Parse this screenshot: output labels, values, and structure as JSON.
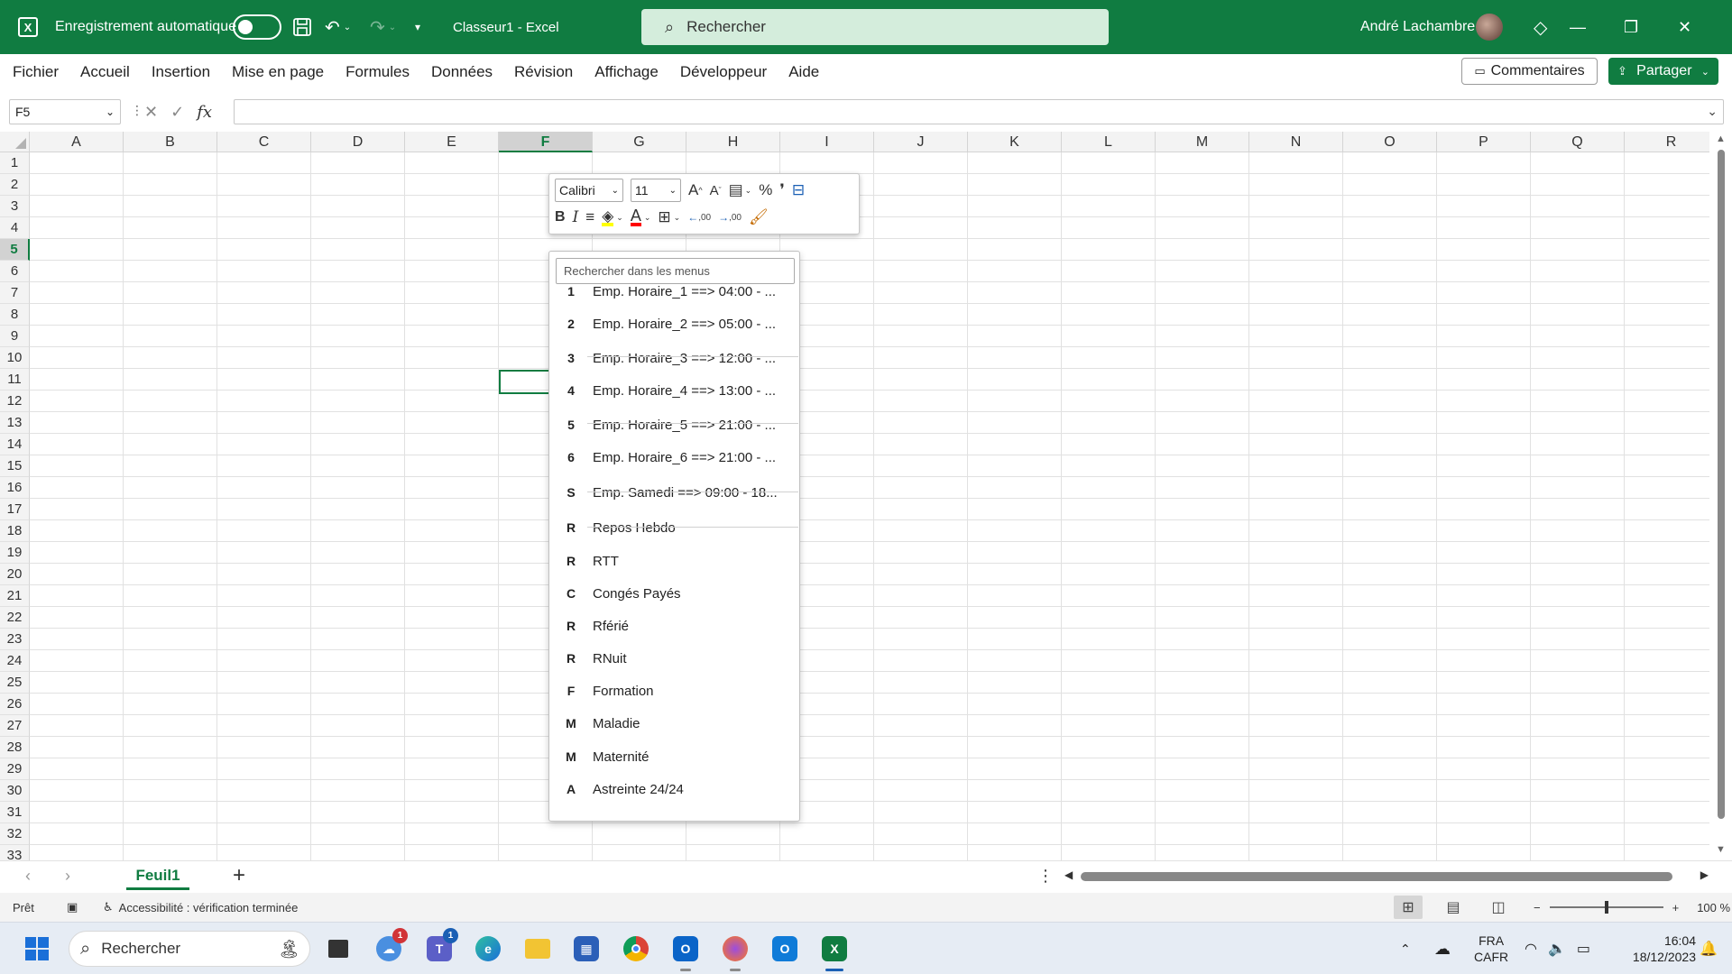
{
  "colors": {
    "accent": "#107C41",
    "titlebar_bg": "#107C41",
    "search_bg": "#d4eddc",
    "fill_color": "#ffff00",
    "font_color": "#ff0000"
  },
  "titlebar": {
    "autosave_label": "Enregistrement automatique",
    "doc_title": "Classeur1  -  Excel",
    "search_placeholder": "Rechercher",
    "user_name": "André Lachambre"
  },
  "menu": {
    "items": [
      "Fichier",
      "Accueil",
      "Insertion",
      "Mise en page",
      "Formules",
      "Données",
      "Révision",
      "Affichage",
      "Développeur",
      "Aide"
    ],
    "comments_label": "Commentaires",
    "share_label": "Partager"
  },
  "formula_bar": {
    "name_box": "F5",
    "fx_label": "fx",
    "formula_value": ""
  },
  "grid": {
    "columns": [
      "A",
      "B",
      "C",
      "D",
      "E",
      "F",
      "G",
      "H",
      "I",
      "J",
      "K",
      "L",
      "M",
      "N",
      "O",
      "P",
      "Q",
      "R"
    ],
    "rows": [
      "1",
      "2",
      "3",
      "4",
      "5",
      "6",
      "7",
      "8",
      "9",
      "10",
      "11",
      "12",
      "13",
      "14",
      "15",
      "16",
      "17",
      "18",
      "19",
      "20",
      "21",
      "22",
      "23",
      "24",
      "25",
      "26",
      "27",
      "28",
      "29",
      "30",
      "31",
      "32",
      "33"
    ],
    "selected_column": "F",
    "selected_row": "5",
    "selected_cell": "F5"
  },
  "mini_toolbar": {
    "font_name": "Calibri",
    "font_size": "11",
    "bold": "B",
    "italic": "I",
    "increase_font": "A",
    "decrease_font": "A",
    "percent": "%",
    "comma": "❜",
    "font_color_letter": "A",
    "inc_decimal": ",00",
    "dec_decimal": ",00"
  },
  "dropdown": {
    "search_placeholder": "Rechercher dans les menus",
    "items": [
      {
        "key": "1",
        "label": "Emp. Horaire_1 ==> 04:00 - ..."
      },
      {
        "key": "2",
        "label": "Emp. Horaire_2 ==> 05:00 - ..."
      },
      {
        "key": "3",
        "label": "Emp. Horaire_3 ==> 12:00 - ..."
      },
      {
        "key": "4",
        "label": "Emp. Horaire_4 ==> 13:00 - ..."
      },
      {
        "key": "5",
        "label": "Emp. Horaire_5 ==> 21:00 - ..."
      },
      {
        "key": "6",
        "label": "Emp. Horaire_6 ==> 21:00 - ..."
      },
      {
        "key": "S",
        "label": "Emp. Samedi ==> 09:00 - 18..."
      },
      {
        "key": "R",
        "label": "Repos Hebdo"
      },
      {
        "key": "R",
        "label": "RTT"
      },
      {
        "key": "C",
        "label": "Congés Payés"
      },
      {
        "key": "R",
        "label": "Rférié"
      },
      {
        "key": "R",
        "label": "RNuit"
      },
      {
        "key": "F",
        "label": "Formation"
      },
      {
        "key": "M",
        "label": "Maladie"
      },
      {
        "key": "M",
        "label": "Maternité"
      },
      {
        "key": "A",
        "label": "Astreinte 24/24"
      }
    ]
  },
  "sheets": {
    "active": "Feuil1",
    "add_label": "+"
  },
  "statusbar": {
    "ready": "Prêt",
    "accessibility": "Accessibilité : vérification terminée",
    "zoom": "100 %",
    "zoom_minus": "−",
    "zoom_plus": "+",
    "zoom_level": 1.0
  },
  "taskbar": {
    "search_placeholder": "Rechercher",
    "apps": [
      {
        "name": "task-view",
        "badge": ""
      },
      {
        "name": "cloud-app",
        "badge": "1"
      },
      {
        "name": "teams",
        "badge": "1"
      },
      {
        "name": "edge",
        "badge": ""
      },
      {
        "name": "file-explorer",
        "badge": ""
      },
      {
        "name": "store",
        "badge": ""
      },
      {
        "name": "chrome",
        "badge": ""
      },
      {
        "name": "outlook-classic",
        "badge": ""
      },
      {
        "name": "firefox",
        "badge": ""
      },
      {
        "name": "outlook-new",
        "badge": ""
      },
      {
        "name": "excel",
        "badge": ""
      }
    ],
    "language": "FRA",
    "keyboard": "CAFR",
    "time": "16:04",
    "date": "18/12/2023"
  }
}
